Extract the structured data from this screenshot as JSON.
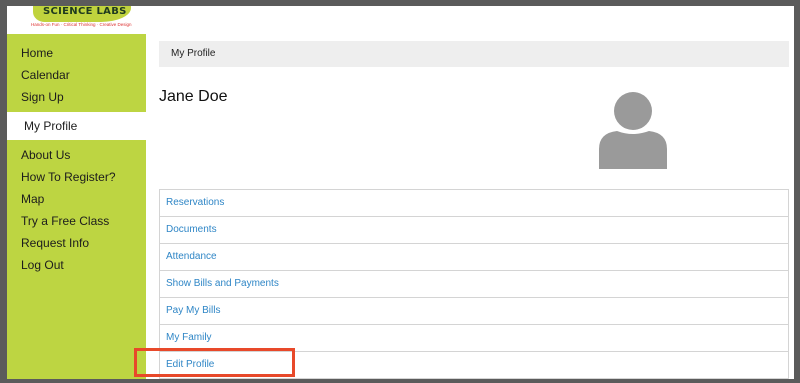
{
  "logo": {
    "name": "SCIENCE LABS",
    "tagline": "Hands-on Fun · Critical Thinking · Creative Design",
    "brand_color": "#bdd542"
  },
  "sidebar": {
    "items": [
      {
        "label": "Home"
      },
      {
        "label": "Calendar"
      },
      {
        "label": "Sign Up"
      },
      {
        "label": "My Profile",
        "active": true
      },
      {
        "label": "About Us"
      },
      {
        "label": "How To Register?"
      },
      {
        "label": "Map"
      },
      {
        "label": "Try a Free Class"
      },
      {
        "label": "Request Info"
      },
      {
        "label": "Log Out"
      }
    ]
  },
  "breadcrumb": {
    "label": "My Profile"
  },
  "profile": {
    "name": "Jane Doe",
    "avatar_icon": "user-silhouette-icon"
  },
  "menu": {
    "items": [
      {
        "label": "Reservations"
      },
      {
        "label": "Documents"
      },
      {
        "label": "Attendance"
      },
      {
        "label": "Show Bills and Payments"
      },
      {
        "label": "Pay My Bills"
      },
      {
        "label": "My Family"
      },
      {
        "label": "Edit Profile",
        "highlighted": true
      }
    ],
    "link_color": "#2f86c6",
    "highlight_color": "#e8492a"
  }
}
